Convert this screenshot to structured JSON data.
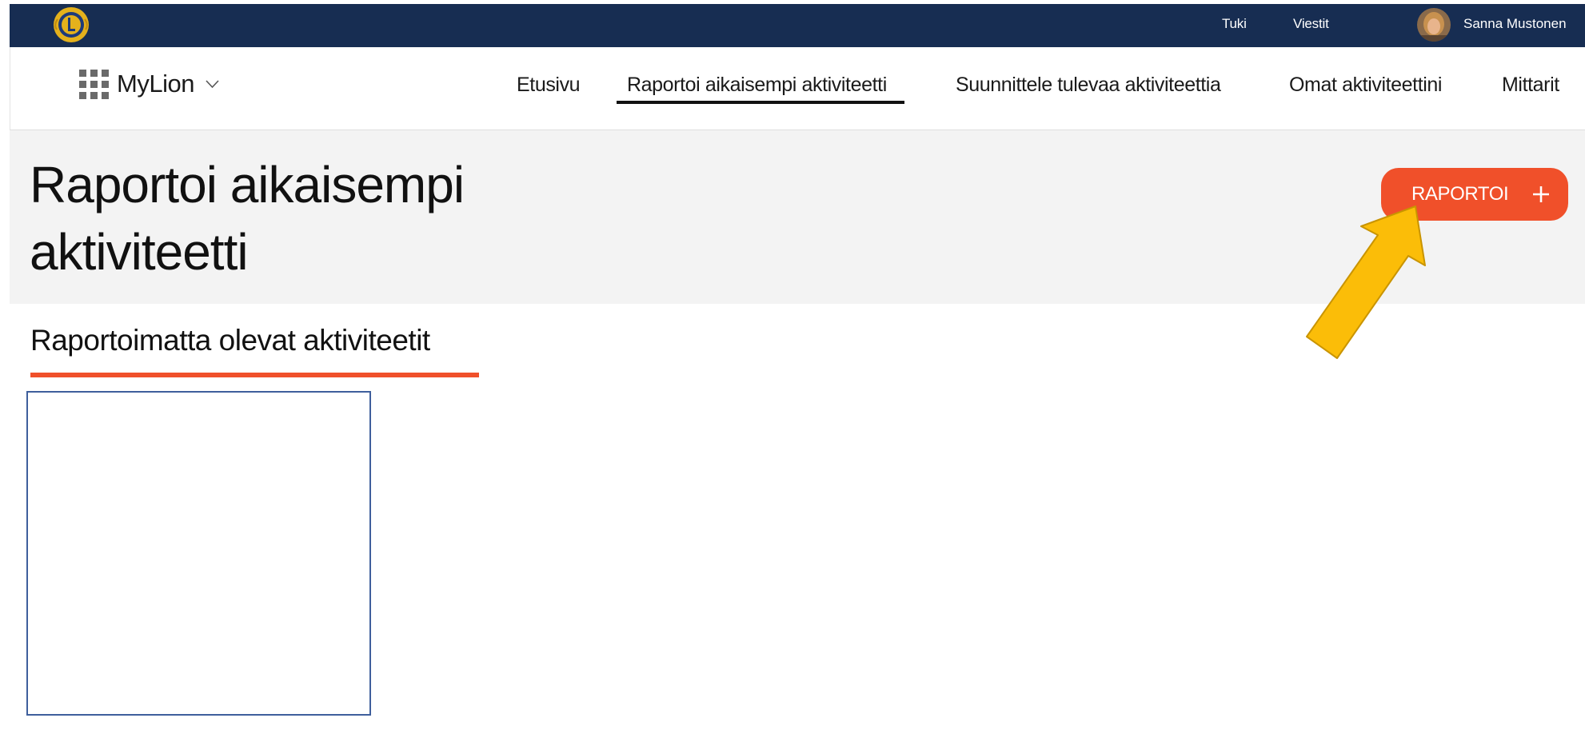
{
  "topbar": {
    "logo_name": "lions-logo",
    "support_link": "Tuki",
    "messages_link": "Viestit",
    "user_name": "Sanna Mustonen",
    "background_color": "#172d52"
  },
  "nav": {
    "brand": "MyLion",
    "items": [
      {
        "label": "Etusivu",
        "active": false
      },
      {
        "label": "Raportoi aikaisempi aktiviteetti",
        "active": true
      },
      {
        "label": "Suunnittele tulevaa aktiviteettia",
        "active": false
      },
      {
        "label": "Omat aktiviteettini",
        "active": false
      },
      {
        "label": "Mittarit",
        "active": false
      }
    ]
  },
  "header": {
    "title_line1": "Raportoi aikaisempi",
    "title_line2": "aktiviteetti",
    "report_button_label": "RAPORTOI",
    "report_button_icon": "plus-icon",
    "accent_color": "#f0502a"
  },
  "section": {
    "title": "Raportoimatta olevat aktiviteetit"
  },
  "annotation": {
    "icon": "arrow-icon",
    "color": "#fbbd08"
  }
}
